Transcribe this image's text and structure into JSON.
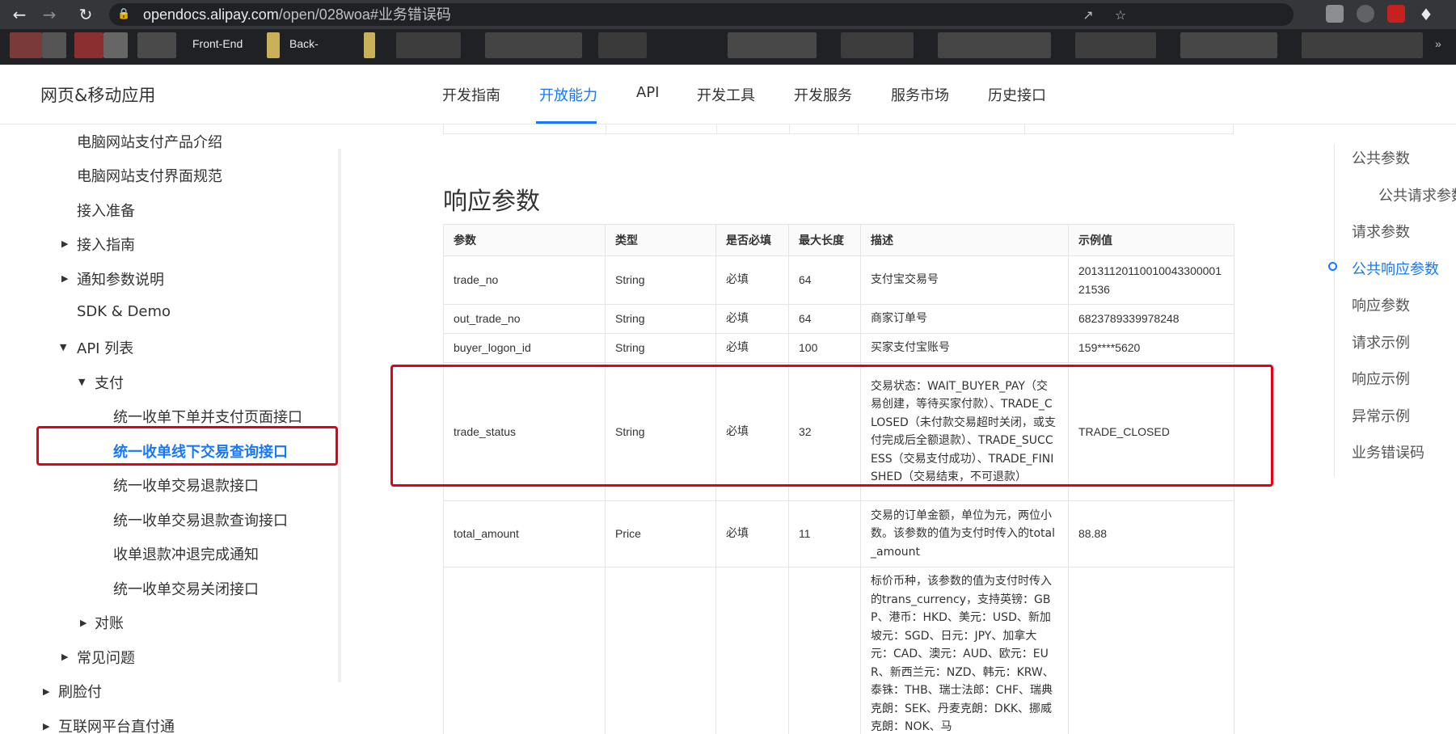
{
  "browser": {
    "url_host": "opendocs.alipay.com",
    "url_path": "/open/028woa#业务错误码",
    "bookmarks": [
      "Front-End",
      "Back-"
    ]
  },
  "header": {
    "brand": "网页&移动应用",
    "nav": [
      "开发指南",
      "开放能力",
      "API",
      "开发工具",
      "开发服务",
      "服务市场",
      "历史接口"
    ],
    "active_nav": "开放能力"
  },
  "sidebar": {
    "items": [
      "电脑网站支付产品介绍",
      "电脑网站支付界面规范",
      "接入准备",
      "接入指南",
      "通知参数说明",
      "SDK & Demo",
      "API 列表",
      "支付",
      "统一收单下单并支付页面接口",
      "统一收单线下交易查询接口",
      "统一收单交易退款接口",
      "统一收单交易退款查询接口",
      "收单退款冲退完成通知",
      "统一收单交易关闭接口",
      "对账",
      "常见问题",
      "刷脸付",
      "互联网平台直付通"
    ]
  },
  "main": {
    "section_title": "响应参数",
    "columns": [
      "参数",
      "类型",
      "是否必填",
      "最大长度",
      "描述",
      "示例值"
    ],
    "rows": [
      [
        "trade_no",
        "String",
        "必填",
        "64",
        "支付宝交易号",
        "2013112011001004330000121536"
      ],
      [
        "out_trade_no",
        "String",
        "必填",
        "64",
        "商家订单号",
        "6823789339978248"
      ],
      [
        "buyer_logon_id",
        "String",
        "必填",
        "100",
        "买家支付宝账号",
        "159****5620"
      ],
      [
        "trade_status",
        "String",
        "必填",
        "32",
        "交易状态：WAIT_BUYER_PAY（交易创建，等待买家付款）、TRADE_CLOSED（未付款交易超时关闭，或支付完成后全额退款）、TRADE_SUCCESS（交易支付成功）、TRADE_FINISHED（交易结束，不可退款）",
        "TRADE_CLOSED"
      ],
      [
        "total_amount",
        "Price",
        "必填",
        "11",
        "交易的订单金额，单位为元，两位小数。该参数的值为支付时传入的total_amount",
        "88.88"
      ],
      [
        "",
        "",
        "",
        "",
        "标价币种，该参数的值为支付时传入的trans_currency，支持英镑：GBP、港币：HKD、美元：USD、新加坡元：SGD、日元：JPY、加拿大元：CAD、澳元：AUD、欧元：EUR、新西兰元：NZD、韩元：KRW、泰铢：THB、瑞士法郎：CHF、瑞典克朗：SEK、丹麦克朗：DKK、挪威克朗：NOK、马",
        ""
      ]
    ]
  },
  "toc": {
    "items": [
      "公共参数",
      "公共请求参数",
      "请求参数",
      "公共响应参数",
      "响应参数",
      "请求示例",
      "响应示例",
      "异常示例",
      "业务错误码"
    ],
    "active": "公共响应参数"
  },
  "colors": {
    "accent": "#1677ff",
    "highlight_box": "#e60012"
  }
}
